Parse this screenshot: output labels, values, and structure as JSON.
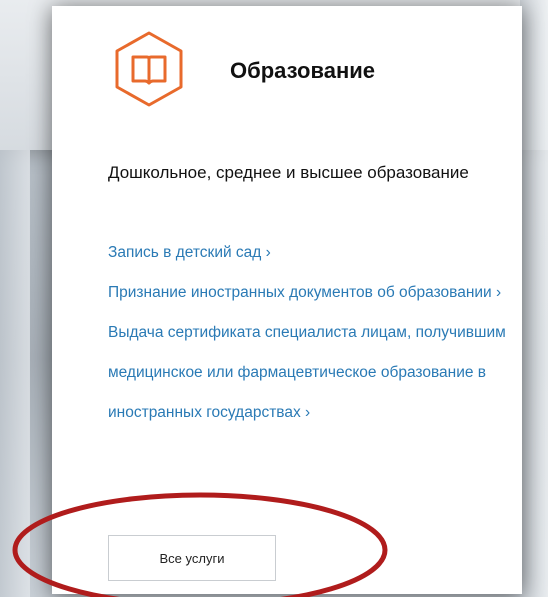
{
  "card": {
    "icon": "open-book-icon",
    "title": "Образование",
    "subtitle": "Дошкольное, среднее и высшее образование",
    "links": [
      "Запись в детский сад ›",
      "Признание иностранных документов об образовании ›",
      "Выдача сертификата специалиста лицам, получившим медицинское или фармацевтическое образование в иностранных государствах ›"
    ],
    "all_services_label": "Все услуги"
  },
  "colors": {
    "icon_orange": "#e86a2c",
    "link_blue": "#2a7ab5",
    "annotation_red": "#b01c1c"
  }
}
